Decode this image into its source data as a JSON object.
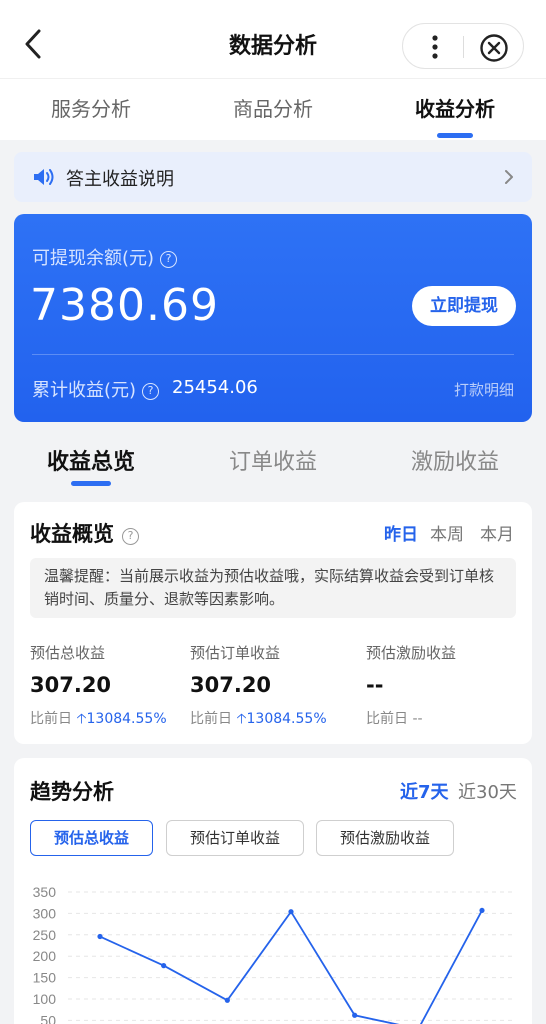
{
  "nav": {
    "title": "数据分析",
    "icons": {
      "back": "chevron-left-icon",
      "more": "more-vertical-icon",
      "close": "close-circle-icon"
    }
  },
  "tabs": [
    {
      "label": "服务分析",
      "active": false
    },
    {
      "label": "商品分析",
      "active": false
    },
    {
      "label": "收益分析",
      "active": true
    }
  ],
  "notice": {
    "text": "答主收益说明",
    "icon": "speaker-icon"
  },
  "balance": {
    "label": "可提现余额(元)",
    "amount": "7380.69",
    "button": "立即提现",
    "cumulative_label": "累计收益(元)",
    "cumulative_value": "25454.06",
    "detail_link": "打款明细"
  },
  "sub_tabs": [
    {
      "label": "收益总览",
      "active": true
    },
    {
      "label": "订单收益",
      "active": false
    },
    {
      "label": "激励收益",
      "active": false
    }
  ],
  "overview": {
    "title": "收益概览",
    "periods": [
      {
        "label": "昨日",
        "active": true
      },
      {
        "label": "本周",
        "active": false
      },
      {
        "label": "本月",
        "active": false
      }
    ],
    "tip": "温馨提醒：当前展示收益为预估收益哦，实际结算收益会受到订单核销时间、质量分、退款等因素影响。",
    "metrics": [
      {
        "label": "预估总收益",
        "value": "307.20",
        "compare_label": "比前日",
        "change": "13084.55%",
        "direction": "up"
      },
      {
        "label": "预估订单收益",
        "value": "307.20",
        "compare_label": "比前日",
        "change": "13084.55%",
        "direction": "up"
      },
      {
        "label": "预估激励收益",
        "value": "--",
        "compare_label": "比前日",
        "change": "--",
        "direction": "none"
      }
    ]
  },
  "trend": {
    "title": "趋势分析",
    "ranges": [
      {
        "label": "近7天",
        "active": true
      },
      {
        "label": "近30天",
        "active": false
      }
    ],
    "chips": [
      {
        "label": "预估总收益",
        "active": true
      },
      {
        "label": "预估订单收益",
        "active": false
      },
      {
        "label": "预估激励收益",
        "active": false
      }
    ]
  },
  "colors": {
    "accent": "#2563eb",
    "card_blue": "#2e72f5",
    "background": "#f2f3f5"
  },
  "chart_data": {
    "type": "line",
    "y_ticks": [
      "350",
      "300",
      "250",
      "200",
      "150",
      "100",
      "50"
    ],
    "ylim": [
      0,
      350
    ],
    "grid": true,
    "series": [
      {
        "values": [
          246,
          178,
          97,
          304,
          62,
          30,
          307
        ]
      }
    ]
  }
}
